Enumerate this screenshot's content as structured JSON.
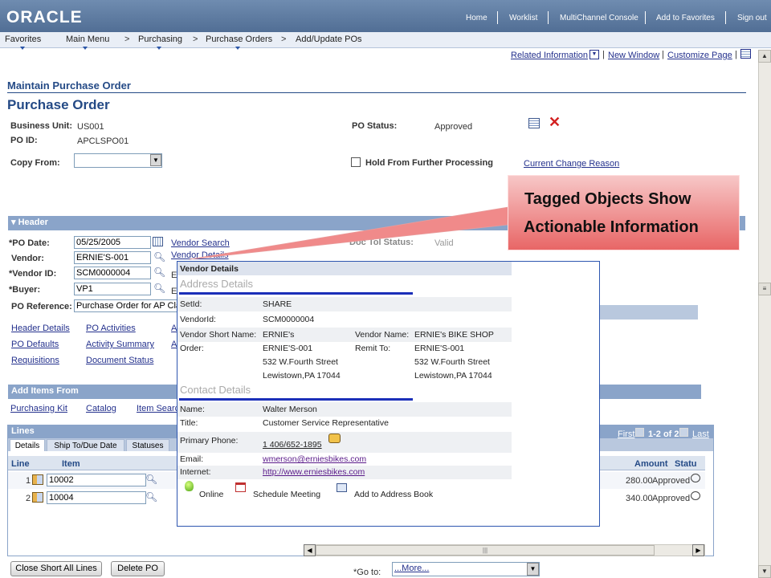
{
  "app": {
    "logo": "ORACLE"
  },
  "topnav": [
    "Home",
    "Worklist",
    "MultiChannel Console",
    "Add to Favorites",
    "Sign out"
  ],
  "breadcrumb": [
    "Favorites",
    "Main Menu",
    "Purchasing",
    "Purchase Orders",
    "Add/Update POs"
  ],
  "breadcrumb_sep": ">",
  "utility": {
    "related": "Related Information",
    "new_window": "New Window",
    "customize": "Customize Page"
  },
  "section_title": "Maintain Purchase Order",
  "page_title": "Purchase Order",
  "po": {
    "business_unit_label": "Business Unit:",
    "business_unit": "US001",
    "po_id_label": "PO ID:",
    "po_id": "APCLSPO01",
    "copy_from_label": "Copy From:",
    "status_label": "PO Status:",
    "status": "Approved",
    "hold_label": "Hold From Further Processing",
    "change_reason": "Current Change Reason"
  },
  "header": {
    "band": "Header",
    "po_date_label": "*PO Date:",
    "po_date": "05/25/2005",
    "vendor_label": "Vendor:",
    "vendor": "ERNIE'S-001",
    "vendor_id_label": "*Vendor ID:",
    "vendor_id": "SCM0000004",
    "buyer_label": "*Buyer:",
    "buyer": "VP1",
    "po_ref_label": "PO Reference:",
    "po_ref": "Purchase Order for AP Cla",
    "vendor_search": "Vendor Search",
    "vendor_details": "Vendor Details",
    "doc_tol_label": "Doc Tol Status:",
    "doc_tol": "Valid",
    "e_letter": "E",
    "a_letter": "A",
    "links_left": [
      "Header Details",
      "PO Defaults",
      "Requisitions"
    ],
    "links_mid": [
      "PO Activities",
      "Activity Summary",
      "Document Status"
    ]
  },
  "add_items": {
    "band": "Add Items From",
    "links": [
      "Purchasing Kit",
      "Catalog",
      "Item Searc"
    ]
  },
  "lines": {
    "band": "Lines",
    "tabs": [
      "Details",
      "Ship To/Due Date",
      "Statuses"
    ],
    "nav": {
      "first": "First",
      "range": "1-2 of 2",
      "last": "Last"
    },
    "columns": {
      "line": "Line",
      "item": "Item",
      "amount": "Amount",
      "status": "Statu"
    },
    "rows": [
      {
        "line": "1",
        "item": "10002",
        "amount": "280.00",
        "status": "Approved"
      },
      {
        "line": "2",
        "item": "10004",
        "amount": "340.00",
        "status": "Approved"
      }
    ]
  },
  "buttons": {
    "close_short": "Close Short All Lines",
    "delete_po": "Delete PO"
  },
  "goto": {
    "label": "*Go to:",
    "value": "...More..."
  },
  "popup": {
    "title": "Vendor Details",
    "address_head": "Address Details",
    "setid_label": "SetId:",
    "setid": "SHARE",
    "vendorid_label": "VendorId:",
    "vendorid": "SCM0000004",
    "short_label": "Vendor Short Name:",
    "short": "ERNIE's",
    "vname_label": "Vendor Name:",
    "vname": "ERNIE's BIKE SHOP",
    "order_label": "Order:",
    "order": "ERNIE'S-001",
    "order_street": "532 W.Fourth Street",
    "order_city": "Lewistown,PA 17044",
    "remit_label": "Remit To:",
    "remit": "ERNIE'S-001",
    "remit_street": "532 W.Fourth Street",
    "remit_city": "Lewistown,PA 17044",
    "contact_head": "Contact Details",
    "name_label": "Name:",
    "name": "Walter Merson",
    "title_label": "Title:",
    "title_val": "Customer Service Representative",
    "phone_label": "Primary Phone:",
    "phone": "1 406/652-1895",
    "email_label": "Email:",
    "email": "wmerson@erniesbikes.com",
    "internet_label": "Internet:",
    "internet": "http://www.erniesbikes.com",
    "online": "Online",
    "meeting": "Schedule Meeting",
    "address_book": "Add to Address Book"
  },
  "callout": {
    "line1": "Tagged Objects Show",
    "line2": "Actionable Information"
  },
  "colors": {
    "brand_bar": "#5a769d",
    "band": "#8aa4c9",
    "title": "#244a86",
    "callout": "#e86565",
    "popup_border": "#2e56b0"
  }
}
